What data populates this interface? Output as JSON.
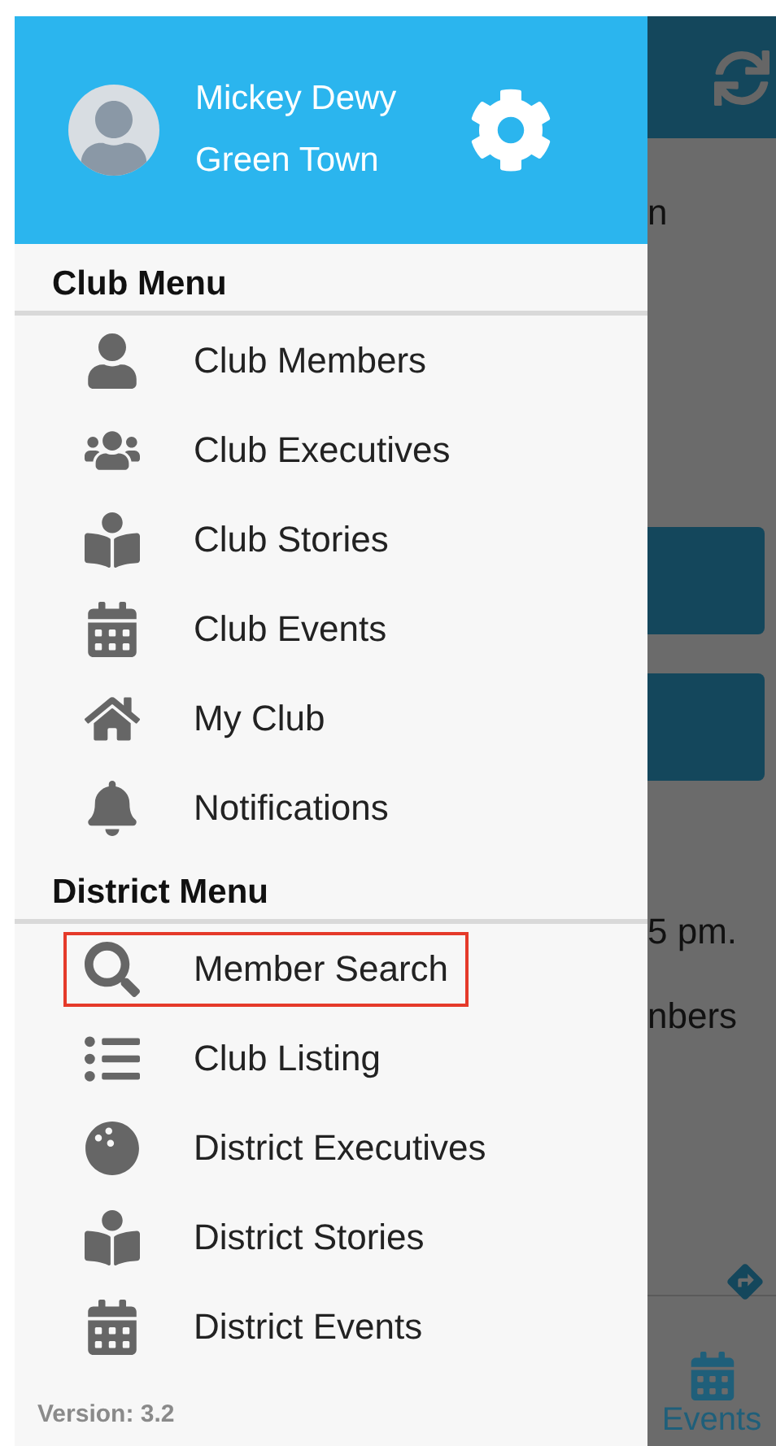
{
  "drawer": {
    "user": {
      "name": "Mickey Dewy",
      "location": "Green Town"
    },
    "sections": [
      {
        "title": "Club Menu",
        "items": [
          {
            "label": "Club Members",
            "highlighted": false
          },
          {
            "label": "Club Executives",
            "highlighted": false
          },
          {
            "label": "Club Stories",
            "highlighted": false
          },
          {
            "label": "Club Events",
            "highlighted": false
          },
          {
            "label": "My Club",
            "highlighted": false
          },
          {
            "label": "Notifications",
            "highlighted": false
          }
        ]
      },
      {
        "title": "District Menu",
        "items": [
          {
            "label": "Member Search",
            "highlighted": true
          },
          {
            "label": "Club Listing",
            "highlighted": false
          },
          {
            "label": "District Executives",
            "highlighted": false
          },
          {
            "label": "District Stories",
            "highlighted": false
          },
          {
            "label": "District Events",
            "highlighted": false
          }
        ]
      }
    ],
    "version": "Version: 3.2"
  },
  "background": {
    "texts": [
      "n",
      "5 pm.",
      "nbers"
    ],
    "nav_label": "Events"
  }
}
